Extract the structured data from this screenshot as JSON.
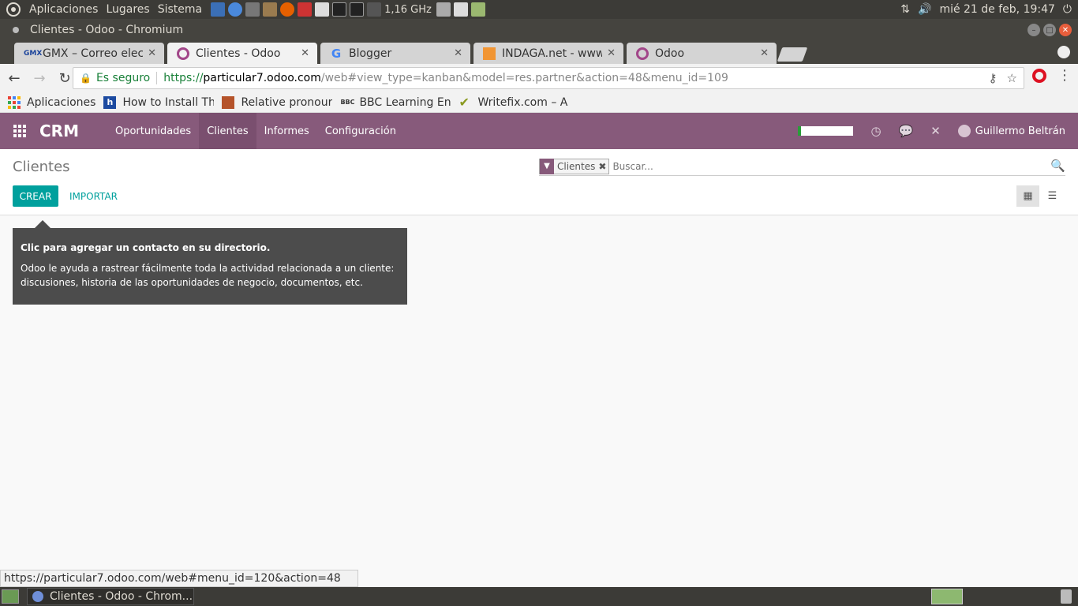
{
  "system_panel": {
    "menus": [
      "Aplicaciones",
      "Lugares",
      "Sistema"
    ],
    "cpu": "1,16 GHz",
    "datetime": "mié 21 de feb, 19:47"
  },
  "window": {
    "title": "Clientes - Odoo - Chromium"
  },
  "tabs": [
    {
      "label": "GMX – Correo electr...",
      "favicon": "gmx-icon"
    },
    {
      "label": "Clientes - Odoo",
      "favicon": "odoo-icon",
      "active": true
    },
    {
      "label": "Blogger",
      "favicon": "google-icon"
    },
    {
      "label": "INDAGA.net - www...",
      "favicon": "indaga-icon"
    },
    {
      "label": "Odoo",
      "favicon": "odoo-icon"
    }
  ],
  "omnibox": {
    "secure_label": "Es seguro",
    "scheme": "https://",
    "host": "particular7.odoo.com",
    "path": "/web#view_type=kanban&model=res.partner&action=48&menu_id=109"
  },
  "bookmarks": [
    {
      "label": "Aplicaciones",
      "icon": "apps-icon"
    },
    {
      "label": "How to Install Th",
      "icon": "h-icon"
    },
    {
      "label": "Relative pronour",
      "icon": "shield-icon"
    },
    {
      "label": "BBC Learning En",
      "icon": "bbc-icon"
    },
    {
      "label": "Writefix.com – A",
      "icon": "check-icon"
    }
  ],
  "odoo_nav": {
    "brand": "CRM",
    "menu": [
      "Oportunidades",
      "Clientes",
      "Informes",
      "Configuración"
    ],
    "active_index": 1,
    "user": "Guillermo Beltrán"
  },
  "control_panel": {
    "title": "Clientes",
    "create_label": "CREAR",
    "import_label": "IMPORTAR",
    "search_facet": "Clientes",
    "search_placeholder": "Buscar..."
  },
  "help": {
    "title": "Clic para agregar un contacto en su directorio.",
    "body": "Odoo le ayuda a rastrear fácilmente toda la actividad relacionada a un cliente: discusiones, historia de las oportunidades de negocio, documentos, etc."
  },
  "status_url": "https://particular7.odoo.com/web#menu_id=120&action=48",
  "taskbar": {
    "task_label": "Clientes - Odoo - Chrom..."
  },
  "colors": {
    "odoo_purple": "#875a7b",
    "odoo_teal": "#00a09d"
  }
}
